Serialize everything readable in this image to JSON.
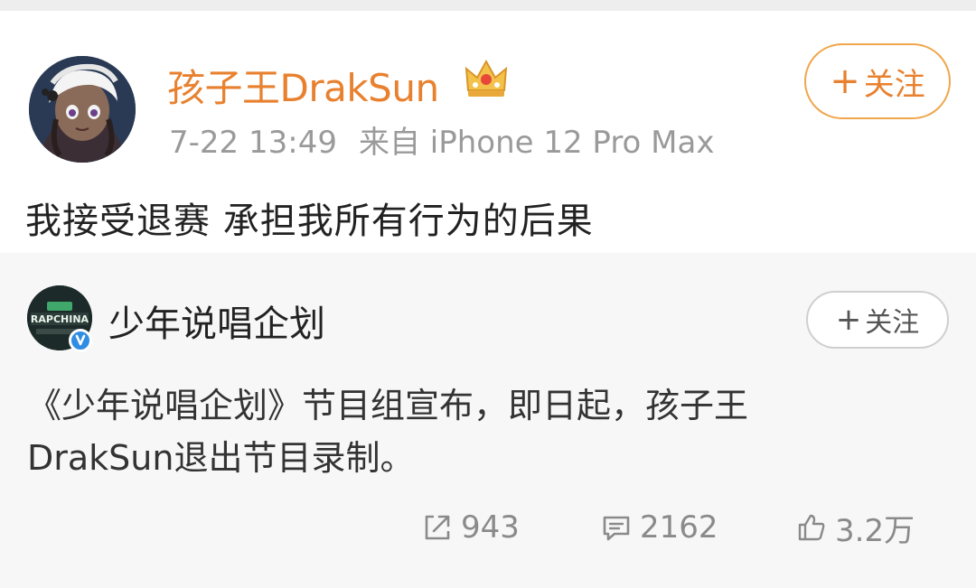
{
  "post": {
    "username": "孩子王DrakSun",
    "badge_icon": "crown-icon",
    "time": "7-22 13:49",
    "source": "来自 iPhone 12 Pro Max",
    "follow_plus": "+",
    "follow_label": "关注",
    "text": "我接受退赛 承担我所有行为的后果"
  },
  "repost": {
    "account_name": "少年说唱企划",
    "avatar_icon": "rapchina-logo-avatar",
    "verified_icon": "verified-badge-icon",
    "follow_plus": "+",
    "follow_label": "关注",
    "text_line1": "《少年说唱企划》节目组宣布，即日起，孩子王",
    "text_line2": "DrakSun退出节目录制。",
    "actions": {
      "share_count": "943",
      "comment_count": "2162",
      "like_count": "3.2万"
    }
  },
  "colors": {
    "username": "#e8812f",
    "follow_border": "#f0a64c",
    "meta": "#9a9a9a",
    "repost_bg": "#f7f7f7",
    "verify_blue": "#2f8de4"
  }
}
